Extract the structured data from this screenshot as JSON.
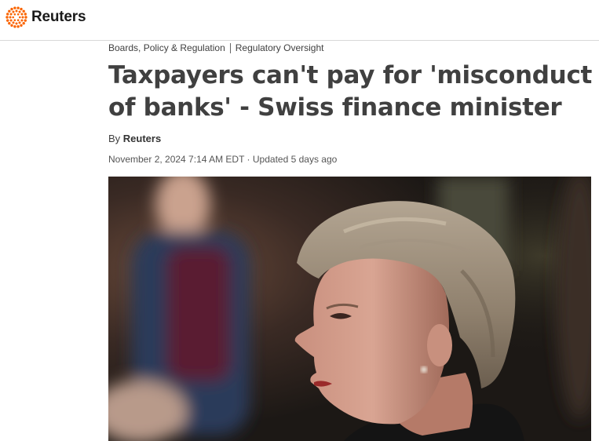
{
  "header": {
    "logo_text": "Reuters",
    "logo_icon": "reuters-dot-ring-icon",
    "brand_color": "#fa6400"
  },
  "breadcrumb": {
    "section": "Boards, Policy & Regulation",
    "subsection": "Regulatory Oversight"
  },
  "article": {
    "headline": "Taxpayers can't pay for 'misconduct of banks' - Swiss finance minister",
    "byline_prefix": "By",
    "author": "Reuters",
    "date": "November 2, 2024 7:14 AM EDT",
    "date_separator": "·",
    "updated": "Updated 5 days ago"
  }
}
